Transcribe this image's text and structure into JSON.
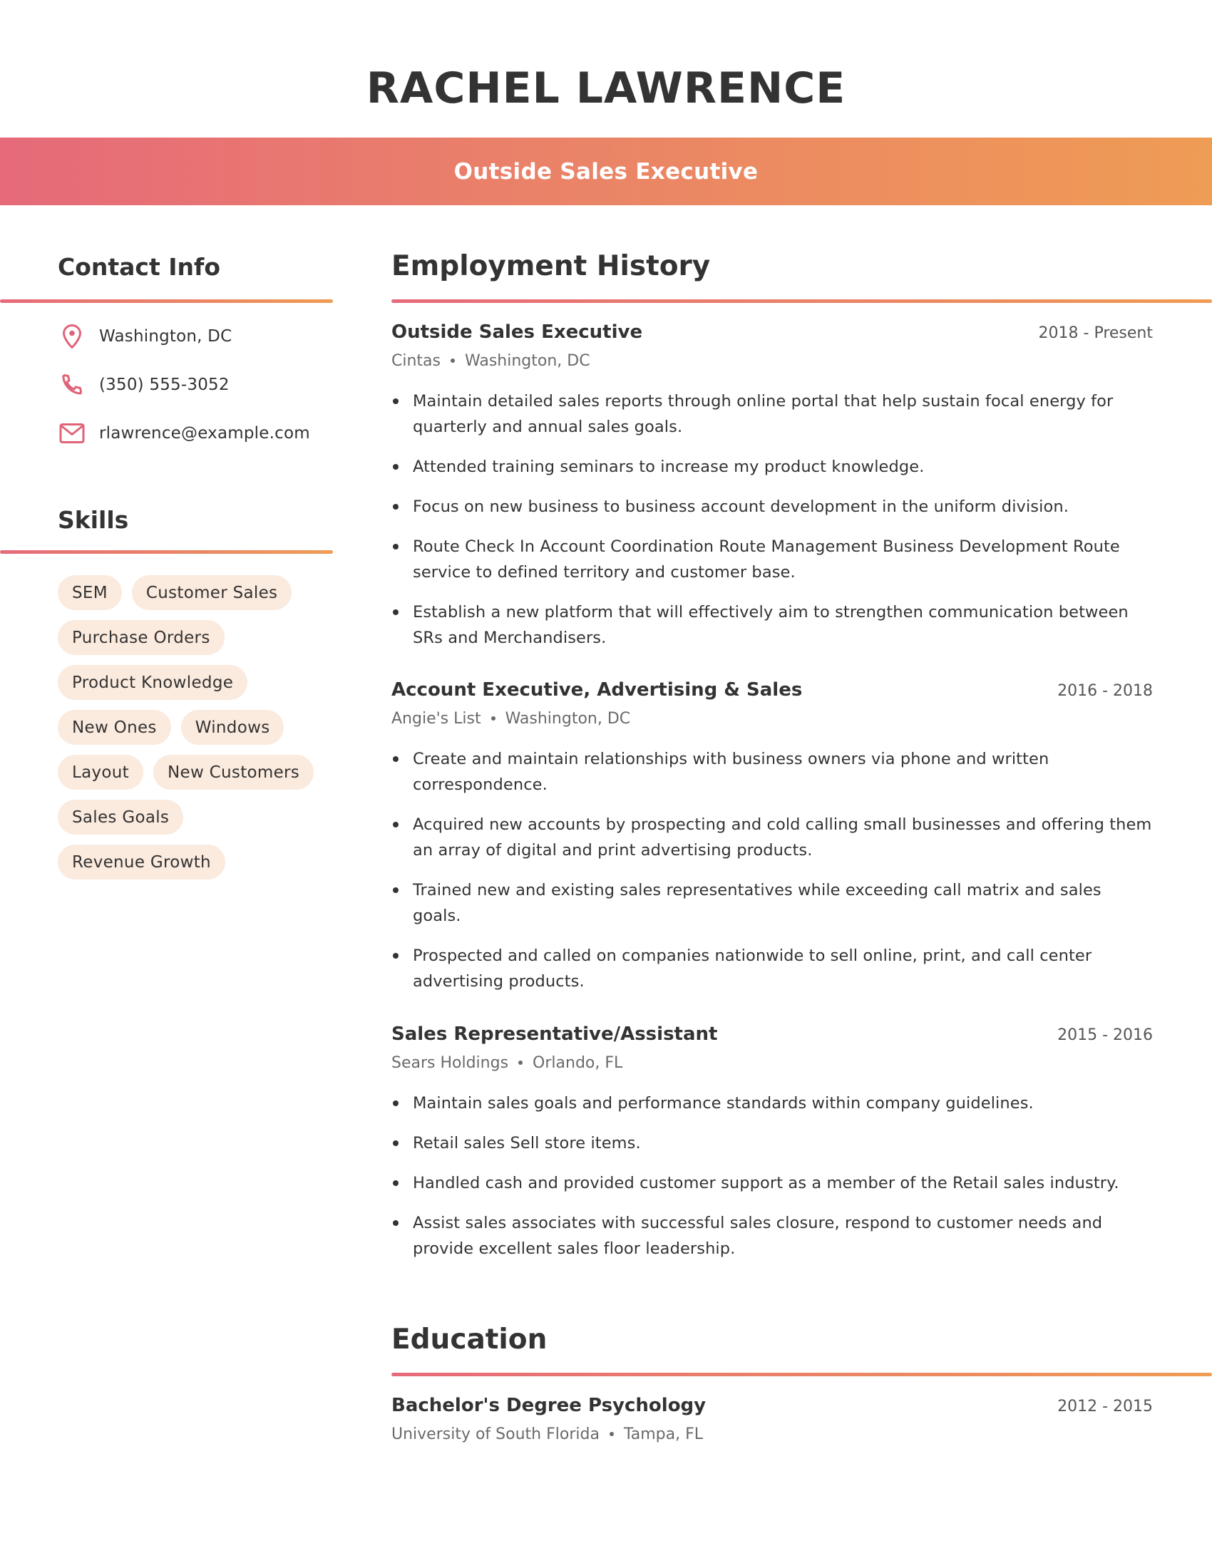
{
  "header": {
    "name": "RACHEL LAWRENCE",
    "job_title": "Outside Sales Executive"
  },
  "theme": {
    "gradient_start": "#E66A7A",
    "gradient_end": "#EF9C55",
    "chip_fill": "#FBEADE",
    "icon_color": "#E06478"
  },
  "contact": {
    "heading": "Contact Info",
    "items": [
      {
        "icon": "map-pin-icon",
        "text": "Washington, DC"
      },
      {
        "icon": "phone-icon",
        "text": "(350) 555-3052"
      },
      {
        "icon": "mail-icon",
        "text": "rlawrence@example.com"
      }
    ]
  },
  "skills": {
    "heading": "Skills",
    "items": [
      "SEM",
      "Customer Sales",
      "Purchase Orders",
      "Product Knowledge",
      "New Ones",
      "Windows",
      "Layout",
      "New Customers",
      "Sales Goals",
      "Revenue Growth"
    ]
  },
  "employment": {
    "heading": "Employment History",
    "jobs": [
      {
        "title": "Outside Sales Executive",
        "dates": "2018 - Present",
        "company": "Cintas",
        "location": "Washington, DC",
        "bullets": [
          "Maintain detailed sales reports through online portal that help sustain focal energy for quarterly and annual sales goals.",
          "Attended training seminars to increase my product knowledge.",
          "Focus on new business to business account development in the uniform division.",
          "Route Check In Account Coordination Route Management Business Development Route service to defined territory and customer base.",
          "Establish a new platform that will effectively aim to strengthen communication between SRs and Merchandisers."
        ]
      },
      {
        "title": "Account Executive, Advertising & Sales",
        "dates": "2016 - 2018",
        "company": "Angie's List",
        "location": "Washington, DC",
        "bullets": [
          "Create and maintain relationships with business owners via phone and written correspondence.",
          "Acquired new accounts by prospecting and cold calling small businesses and offering them an array of digital and print advertising products.",
          "Trained new and existing sales representatives while exceeding call matrix and sales goals.",
          "Prospected and called on companies nationwide to sell online, print, and call center advertising products."
        ]
      },
      {
        "title": "Sales Representative/Assistant",
        "dates": "2015 - 2016",
        "company": "Sears Holdings",
        "location": "Orlando, FL",
        "bullets": [
          "Maintain sales goals and performance standards within company guidelines.",
          "Retail sales Sell store items.",
          "Handled cash and provided customer support as a member of the Retail sales industry.",
          "Assist sales associates with successful sales closure, respond to customer needs and provide excellent sales floor leadership."
        ]
      }
    ]
  },
  "education": {
    "heading": "Education",
    "items": [
      {
        "degree": "Bachelor's Degree Psychology",
        "dates": "2012 - 2015",
        "school": "University of South Florida",
        "location": "Tampa, FL"
      }
    ]
  }
}
